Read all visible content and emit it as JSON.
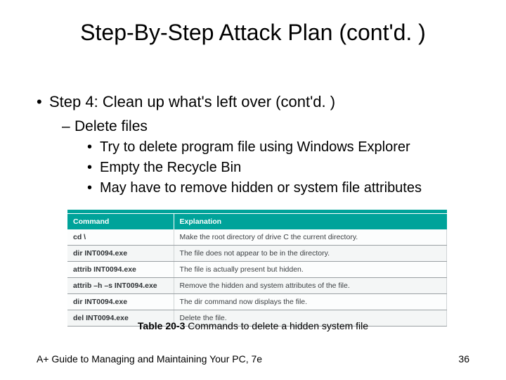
{
  "title": "Step-By-Step Attack Plan (cont'd. )",
  "step": "Step 4: Clean up what's left over (cont'd. )",
  "sub": "Delete files",
  "items": [
    "Try to delete program file using Windows Explorer",
    "Empty the Recycle Bin",
    "May have to remove hidden or system file attributes"
  ],
  "table": {
    "headers": [
      "Command",
      "Explanation"
    ],
    "rows": [
      [
        "cd \\",
        "Make the root directory of drive C the current directory."
      ],
      [
        "dir INT0094.exe",
        "The file does not appear to be in the directory."
      ],
      [
        "attrib INT0094.exe",
        "The file is actually present but hidden."
      ],
      [
        "attrib –h –s INT0094.exe",
        "Remove the hidden and system attributes of the file."
      ],
      [
        "dir INT0094.exe",
        "The dir command now displays the file."
      ],
      [
        "del INT0094.exe",
        "Delete the file."
      ]
    ]
  },
  "caption_label": "Table 20-3",
  "caption_text": " Commands to delete a hidden system file",
  "footer_left": "A+ Guide to Managing and Maintaining Your PC, 7e",
  "footer_right": "36"
}
